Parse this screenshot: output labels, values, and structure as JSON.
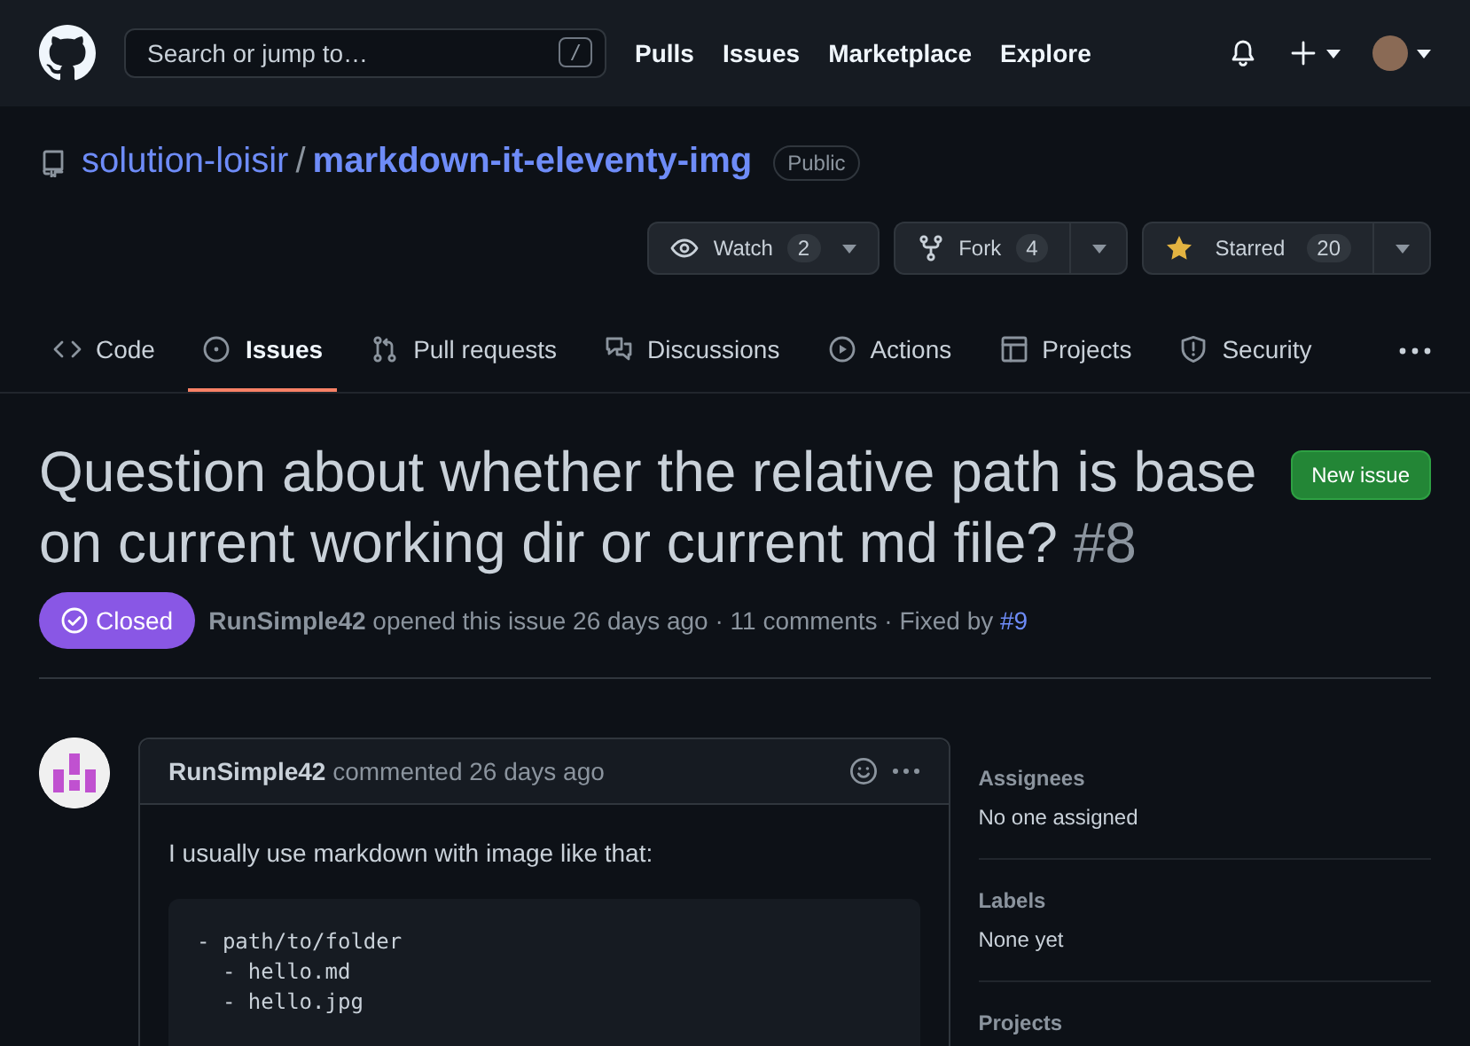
{
  "header": {
    "search": {
      "placeholder": "Search or jump to…",
      "shortcut": "/"
    },
    "nav": [
      "Pulls",
      "Issues",
      "Marketplace",
      "Explore"
    ]
  },
  "repo": {
    "owner": "solution-loisir",
    "separator": "/",
    "name": "markdown-it-eleventy-img",
    "visibility": "Public",
    "actions": [
      {
        "kind": "watch",
        "label": "Watch",
        "count": "2"
      },
      {
        "kind": "fork",
        "label": "Fork",
        "count": "4"
      },
      {
        "kind": "star",
        "label": "Starred",
        "count": "20"
      }
    ]
  },
  "tabs": [
    {
      "kind": "code",
      "label": "Code",
      "selected": false
    },
    {
      "kind": "issues",
      "label": "Issues",
      "selected": true
    },
    {
      "kind": "pulls",
      "label": "Pull requests",
      "selected": false
    },
    {
      "kind": "discussions",
      "label": "Discussions",
      "selected": false
    },
    {
      "kind": "actions",
      "label": "Actions",
      "selected": false
    },
    {
      "kind": "projects",
      "label": "Projects",
      "selected": false
    },
    {
      "kind": "security",
      "label": "Security",
      "selected": false
    }
  ],
  "issue": {
    "title": "Question about whether the relative path is base on current working dir or current md file?",
    "number": "#8",
    "new_button": "New issue",
    "state": {
      "kind": "closed",
      "label": "Closed"
    },
    "author": "RunSimple42",
    "meta": "opened this issue 26 days ago · 11 comments · Fixed by",
    "fixed_by": "#9"
  },
  "comment": {
    "author": "RunSimple42",
    "meta": "commented 26 days ago",
    "body": "I usually use markdown with image like that:",
    "code": "- path/to/folder\n  - hello.md\n  - hello.jpg"
  },
  "sidebar": [
    {
      "heading": "Assignees",
      "value": "No one assigned"
    },
    {
      "heading": "Labels",
      "value": "None yet"
    },
    {
      "heading": "Projects"
    }
  ]
}
